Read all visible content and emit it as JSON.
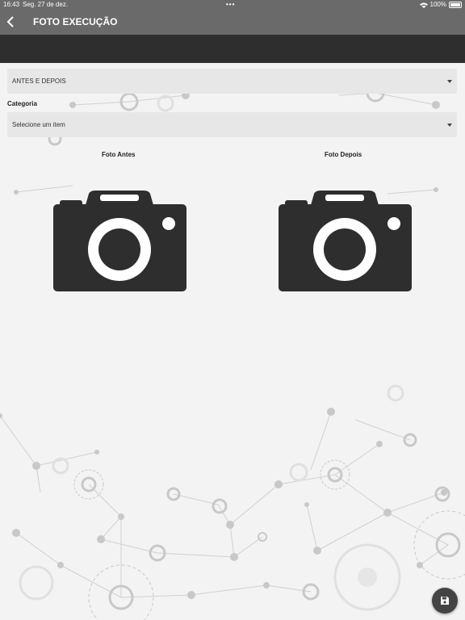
{
  "status": {
    "time": "16:43",
    "date": "Seg. 27 de dez.",
    "dots": "•••",
    "battery": "100%"
  },
  "header": {
    "title": "FOTO EXECUÇÃO"
  },
  "form": {
    "tipo": {
      "value": "ANTES E DEPOIS"
    },
    "categoria": {
      "label": "Categoria",
      "placeholder": "Selecione um item"
    }
  },
  "photos": {
    "before_label": "Foto Antes",
    "after_label": "Foto Depois"
  },
  "icons": {
    "back": "chevron-left-icon",
    "camera": "camera-icon",
    "save": "save-icon"
  },
  "colors": {
    "nav": "#6a6a6a",
    "dark_bar": "#2e2e2e",
    "camera": "#2e2e2e",
    "fab": "#444444"
  }
}
